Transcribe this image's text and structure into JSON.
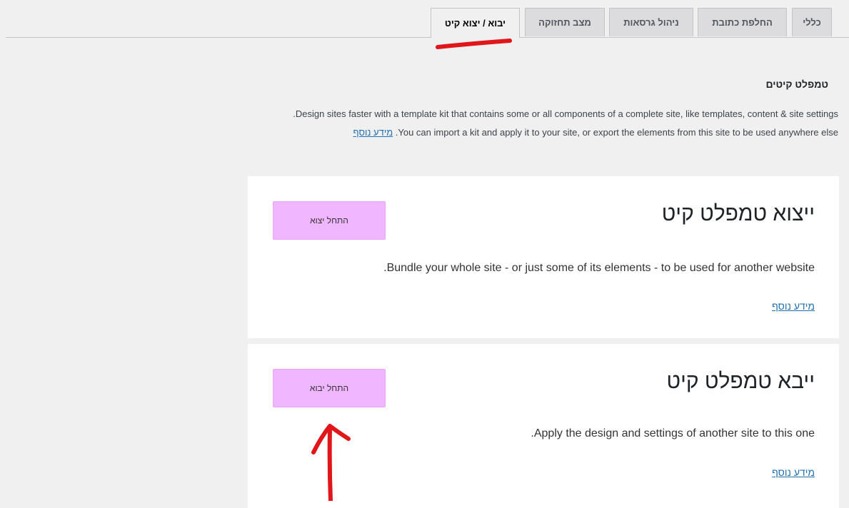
{
  "tabs": [
    {
      "label": "כללי",
      "active": false
    },
    {
      "label": "החלפת כתובת",
      "active": false
    },
    {
      "label": "ניהול גרסאות",
      "active": false
    },
    {
      "label": "מצב תחזוקה",
      "active": false
    },
    {
      "label": "יבוא / יצוא קיט",
      "active": true
    }
  ],
  "section": {
    "title": "טמפלט קיטים",
    "line1": ".Design sites faster with a template kit that contains some or all components of a complete site, like templates, content & site settings",
    "line2_text": " .You can import a kit and apply it to your site, or export the elements from this site to be used anywhere else",
    "line2_link": "מידע נוסף"
  },
  "export_card": {
    "title": "ייצוא טמפלט קיט",
    "button": "התחל יצוא",
    "description": ".Bundle your whole site - or just some of its elements - to be used for another website",
    "link": "מידע נוסף"
  },
  "import_card": {
    "title": "ייבא טמפלט קיט",
    "button": "התחל יבוא",
    "description": ".Apply the design and settings of another site to this one",
    "link": "מידע נוסף"
  },
  "colors": {
    "button_bg": "#f0b6ff",
    "link": "#2271b1",
    "annotation": "#e0161b"
  }
}
